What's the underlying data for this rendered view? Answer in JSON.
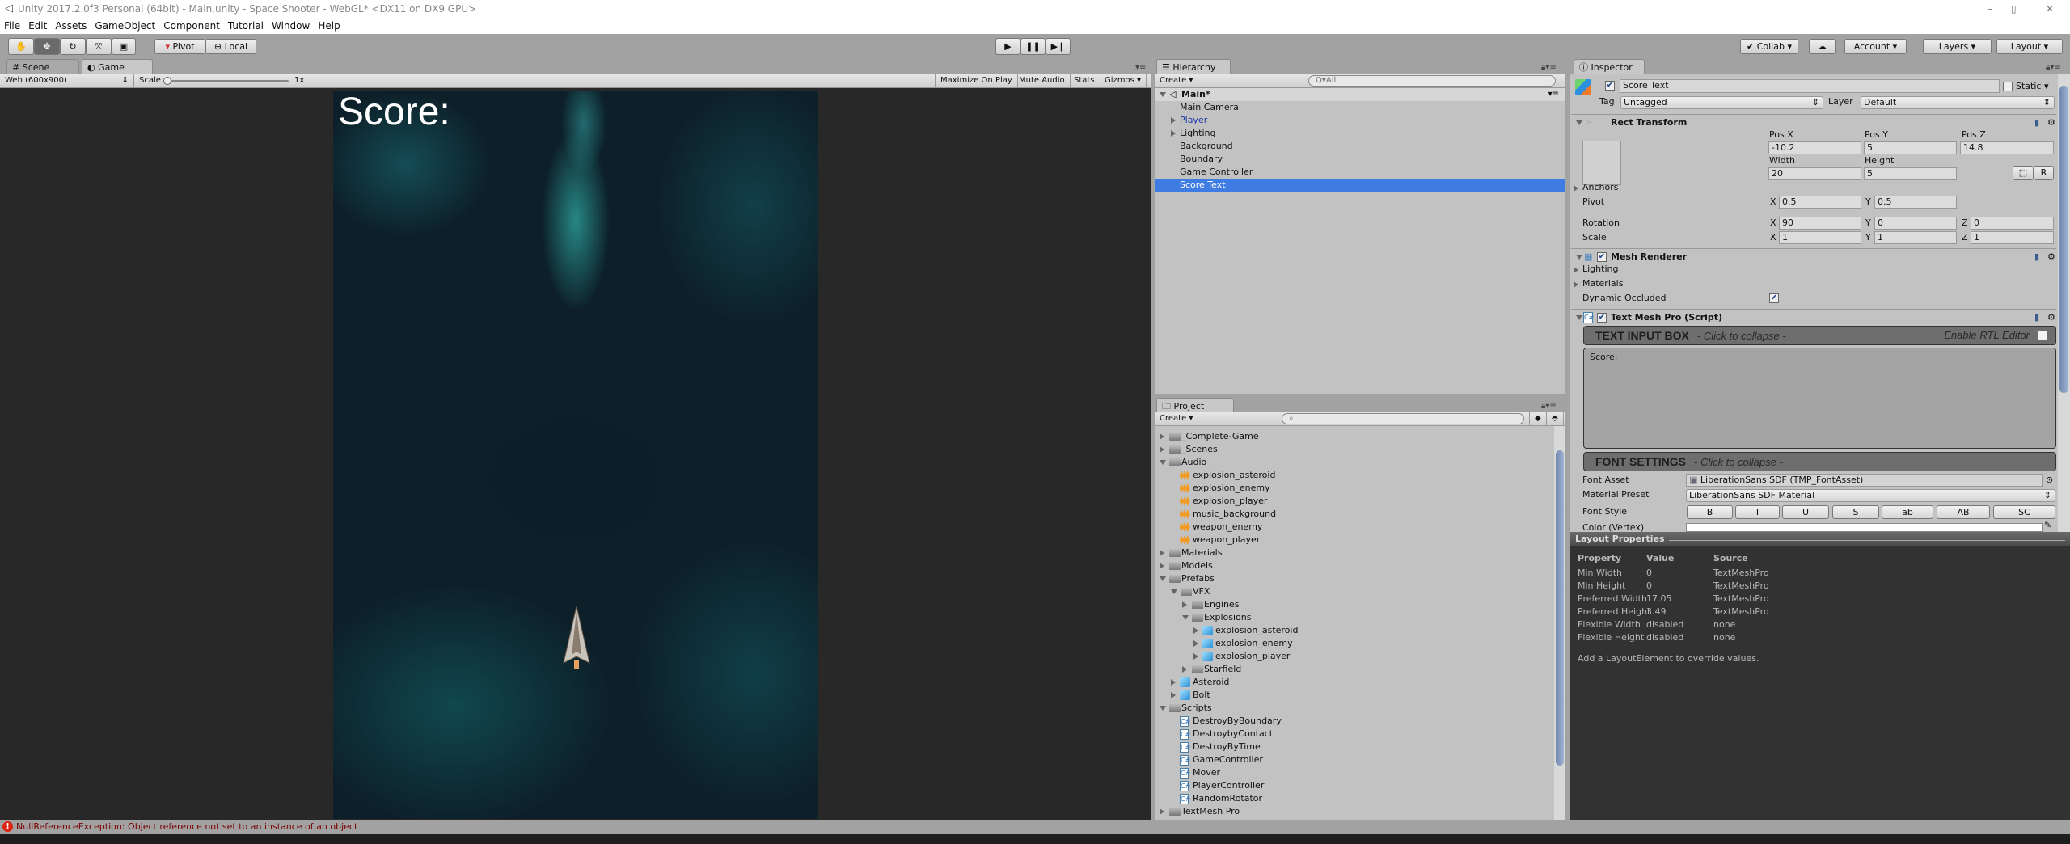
{
  "window": {
    "title": "Unity 2017.2.0f3 Personal (64bit) - Main.unity - Space Shooter - WebGL* <DX11 on DX9 GPU>",
    "controls": [
      "–",
      "▯",
      "✕"
    ]
  },
  "menu": [
    "File",
    "Edit",
    "Assets",
    "GameObject",
    "Component",
    "Tutorial",
    "Window",
    "Help"
  ],
  "toolbar": {
    "tools": [
      "hand-icon",
      "move-icon",
      "rotate-icon",
      "scale-icon",
      "rect-icon"
    ],
    "pivot_label": "Pivot",
    "local_label": "Local",
    "collab_label": "Collab",
    "account_label": "Account",
    "layers_label": "Layers",
    "layout_label": "Layout"
  },
  "game_panel": {
    "tabs": [
      {
        "label": "Scene",
        "icon": "#"
      },
      {
        "label": "Game",
        "icon": "◐"
      }
    ],
    "resolution": "Web (600x900)",
    "scale_label": "Scale",
    "scale_value": "1x",
    "buttons": [
      "Maximize On Play",
      "Mute Audio",
      "Stats",
      "Gizmos"
    ],
    "score_text": "Score:"
  },
  "hierarchy": {
    "tab": "Hierarchy",
    "create": "Create",
    "search_placeholder": "Q▾All",
    "scene": "Main*",
    "items": [
      {
        "label": "Main Camera",
        "expandable": false
      },
      {
        "label": "Player",
        "expandable": true,
        "prefab": true
      },
      {
        "label": "Lighting",
        "expandable": true
      },
      {
        "label": "Background",
        "expandable": false
      },
      {
        "label": "Boundary",
        "expandable": false
      },
      {
        "label": "Game Controller",
        "expandable": false
      },
      {
        "label": "Score Text",
        "expandable": false,
        "selected": true
      }
    ]
  },
  "project": {
    "tab": "Project",
    "create": "Create",
    "items": [
      {
        "label": "_Complete-Game",
        "level": 0,
        "type": "folder",
        "state": "closed"
      },
      {
        "label": "_Scenes",
        "level": 0,
        "type": "folder",
        "state": "closed"
      },
      {
        "label": "Audio",
        "level": 0,
        "type": "folder",
        "state": "open"
      },
      {
        "label": "explosion_asteroid",
        "level": 1,
        "type": "audio"
      },
      {
        "label": "explosion_enemy",
        "level": 1,
        "type": "audio"
      },
      {
        "label": "explosion_player",
        "level": 1,
        "type": "audio"
      },
      {
        "label": "music_background",
        "level": 1,
        "type": "audio"
      },
      {
        "label": "weapon_enemy",
        "level": 1,
        "type": "audio"
      },
      {
        "label": "weapon_player",
        "level": 1,
        "type": "audio"
      },
      {
        "label": "Materials",
        "level": 0,
        "type": "folder",
        "state": "closed"
      },
      {
        "label": "Models",
        "level": 0,
        "type": "folder",
        "state": "closed"
      },
      {
        "label": "Prefabs",
        "level": 0,
        "type": "folder",
        "state": "open"
      },
      {
        "label": "VFX",
        "level": 1,
        "type": "folder",
        "state": "open"
      },
      {
        "label": "Engines",
        "level": 2,
        "type": "folder",
        "state": "closed"
      },
      {
        "label": "Explosions",
        "level": 2,
        "type": "folder",
        "state": "open"
      },
      {
        "label": "explosion_asteroid",
        "level": 3,
        "type": "prefab",
        "state": "closed"
      },
      {
        "label": "explosion_enemy",
        "level": 3,
        "type": "prefab",
        "state": "closed"
      },
      {
        "label": "explosion_player",
        "level": 3,
        "type": "prefab",
        "state": "closed"
      },
      {
        "label": "Starfield",
        "level": 2,
        "type": "folder",
        "state": "closed"
      },
      {
        "label": "Asteroid",
        "level": 1,
        "type": "prefab",
        "state": "closed"
      },
      {
        "label": "Bolt",
        "level": 1,
        "type": "prefab",
        "state": "closed"
      },
      {
        "label": "Scripts",
        "level": 0,
        "type": "folder",
        "state": "open"
      },
      {
        "label": "DestroyByBoundary",
        "level": 1,
        "type": "script"
      },
      {
        "label": "DestroybyContact",
        "level": 1,
        "type": "script"
      },
      {
        "label": "DestroyByTime",
        "level": 1,
        "type": "script"
      },
      {
        "label": "GameController",
        "level": 1,
        "type": "script"
      },
      {
        "label": "Mover",
        "level": 1,
        "type": "script"
      },
      {
        "label": "PlayerController",
        "level": 1,
        "type": "script"
      },
      {
        "label": "RandomRotator",
        "level": 1,
        "type": "script"
      },
      {
        "label": "TextMesh Pro",
        "level": 0,
        "type": "folder",
        "state": "closed"
      }
    ]
  },
  "inspector": {
    "tab": "Inspector",
    "object_name": "Score Text",
    "active": true,
    "static_label": "Static",
    "tag_label": "Tag",
    "tag_value": "Untagged",
    "layer_label": "Layer",
    "layer_value": "Default",
    "rect_transform": {
      "title": "Rect Transform",
      "pos_x_label": "Pos X",
      "pos_y_label": "Pos Y",
      "pos_z_label": "Pos Z",
      "pos_x": "-10.2",
      "pos_y": "5",
      "pos_z": "14.8",
      "width_label": "Width",
      "height_label": "Height",
      "width": "20",
      "height": "5",
      "r_button": "R",
      "anchors_label": "Anchors",
      "pivot_label": "Pivot",
      "pivot_x": "0.5",
      "pivot_y": "0.5",
      "rotation_label": "Rotation",
      "rot_x": "90",
      "rot_y": "0",
      "rot_z": "0",
      "scale_label": "Scale",
      "scale_x": "1",
      "scale_y": "1",
      "scale_z": "1",
      "x": "X",
      "y": "Y",
      "z": "Z"
    },
    "mesh_renderer": {
      "title": "Mesh Renderer",
      "lighting": "Lighting",
      "materials": "Materials",
      "dynamic_occluded": "Dynamic Occluded",
      "dynamic_occluded_checked": true
    },
    "tmp": {
      "title": "Text Mesh Pro (Script)",
      "text_input_box": "TEXT INPUT BOX",
      "collapse_hint": "- Click to collapse -",
      "rtl_label": "Enable RTL Editor",
      "text_value": "Score:",
      "font_settings": "FONT SETTINGS",
      "font_asset_label": "Font Asset",
      "font_asset_value": "LiberationSans SDF (TMP_FontAsset)",
      "material_preset_label": "Material Preset",
      "material_preset_value": "LiberationSans SDF Material",
      "font_style_label": "Font Style",
      "font_styles": [
        "B",
        "I",
        "U",
        "S",
        "ab",
        "AB",
        "SC"
      ],
      "color_label": "Color (Vertex)"
    },
    "layout_properties": {
      "title": "Layout Properties",
      "headers": [
        "Property",
        "Value",
        "Source"
      ],
      "rows": [
        [
          "Min Width",
          "0",
          "TextMeshPro"
        ],
        [
          "Min Height",
          "0",
          "TextMeshPro"
        ],
        [
          "Preferred Width",
          "17.05",
          "TextMeshPro"
        ],
        [
          "Preferred Height",
          "3.49",
          "TextMeshPro"
        ],
        [
          "Flexible Width",
          "disabled",
          "none"
        ],
        [
          "Flexible Height",
          "disabled",
          "none"
        ]
      ],
      "note": "Add a LayoutElement to override values."
    }
  },
  "status": {
    "message": "NullReferenceException: Object reference not set to an instance of an object",
    "color": "#7a0000"
  },
  "colors": {
    "selection": "#3e7ce4",
    "prefab_text": "#1a3aa8",
    "panel": "#c2c2c2",
    "game_bg": "#0c1a22"
  }
}
